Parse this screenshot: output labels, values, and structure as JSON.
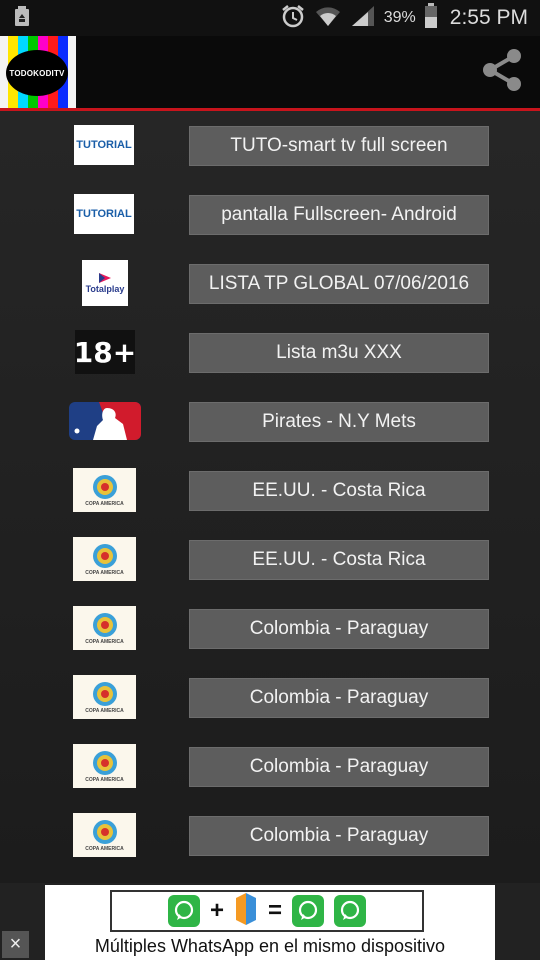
{
  "status_bar": {
    "battery_percent": "39%",
    "time": "2:55 PM",
    "icons": [
      "recycle-icon",
      "alarm-icon",
      "wifi-icon",
      "signal-icon",
      "battery-icon"
    ]
  },
  "app_bar": {
    "logo_text": "TODOKODITV",
    "share_icon": "share-icon",
    "accent_color": "#c8141c"
  },
  "items": [
    {
      "thumb": "tutorial",
      "thumb_text": "TUTORIAL",
      "label": "TUTO-smart tv full screen"
    },
    {
      "thumb": "tutorial",
      "thumb_text": "TUTORIAL",
      "label": "pantalla Fullscreen- Android"
    },
    {
      "thumb": "totalplay",
      "thumb_text": "Totalplay",
      "label": "LISTA TP GLOBAL 07/06/2016"
    },
    {
      "thumb": "adult",
      "thumb_text": "18+",
      "label": "Lista m3u XXX"
    },
    {
      "thumb": "mlb",
      "thumb_text": "",
      "label": "Pirates - N.Y Mets"
    },
    {
      "thumb": "copa",
      "thumb_text": "COPA AMERICA",
      "label": "EE.UU. - Costa Rica"
    },
    {
      "thumb": "copa",
      "thumb_text": "COPA AMERICA",
      "label": "EE.UU. - Costa Rica"
    },
    {
      "thumb": "copa",
      "thumb_text": "COPA AMERICA",
      "label": "Colombia - Paraguay"
    },
    {
      "thumb": "copa",
      "thumb_text": "COPA AMERICA",
      "label": "Colombia - Paraguay"
    },
    {
      "thumb": "copa",
      "thumb_text": "COPA AMERICA",
      "label": "Colombia - Paraguay"
    },
    {
      "thumb": "copa",
      "thumb_text": "COPA AMERICA",
      "label": "Colombia - Paraguay"
    }
  ],
  "ad": {
    "text": "Múltiples WhatsApp en el mismo dispositivo",
    "plus": "+",
    "equals": "=",
    "close": "×"
  }
}
